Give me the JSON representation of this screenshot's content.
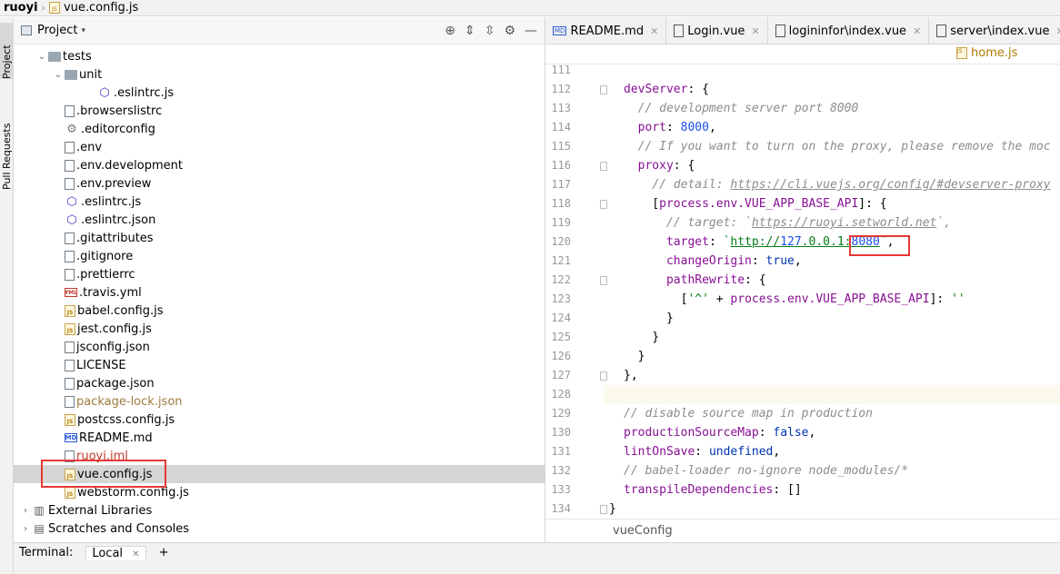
{
  "breadcrumb": {
    "root": "ruoyi",
    "file": "vue.config.js"
  },
  "side_tabs": {
    "project": "Project",
    "pull_requests": "Pull Requests"
  },
  "project_panel": {
    "title": "Project"
  },
  "tree": [
    {
      "name": "tests",
      "icon": "folder-icon",
      "indent": 1,
      "chev": "v"
    },
    {
      "name": "unit",
      "icon": "folder-icon",
      "indent": 2,
      "chev": "v"
    },
    {
      "name": ".eslintrc.js",
      "icon": "eslint-icon",
      "indent": 4
    },
    {
      "name": ".browserslistrc",
      "icon": "file-icon",
      "indent": 2
    },
    {
      "name": ".editorconfig",
      "icon": "gear-icon",
      "indent": 2
    },
    {
      "name": ".env",
      "icon": "file-icon",
      "indent": 2
    },
    {
      "name": ".env.development",
      "icon": "file-icon",
      "indent": 2
    },
    {
      "name": ".env.preview",
      "icon": "file-icon",
      "indent": 2
    },
    {
      "name": ".eslintrc.js",
      "icon": "eslint-icon",
      "indent": 2
    },
    {
      "name": ".eslintrc.json",
      "icon": "eslint-icon",
      "indent": 2
    },
    {
      "name": ".gitattributes",
      "icon": "file-icon",
      "indent": 2
    },
    {
      "name": ".gitignore",
      "icon": "file-icon",
      "indent": 2
    },
    {
      "name": ".prettierrc",
      "icon": "file-icon",
      "indent": 2
    },
    {
      "name": ".travis.yml",
      "icon": "yml-icon",
      "indent": 2
    },
    {
      "name": "babel.config.js",
      "icon": "js-icon",
      "indent": 2
    },
    {
      "name": "jest.config.js",
      "icon": "js-icon",
      "indent": 2
    },
    {
      "name": "jsconfig.json",
      "icon": "file-icon",
      "indent": 2
    },
    {
      "name": "LICENSE",
      "icon": "file-icon",
      "indent": 2
    },
    {
      "name": "package.json",
      "icon": "file-icon",
      "indent": 2
    },
    {
      "name": "package-lock.json",
      "icon": "file-icon",
      "indent": 2,
      "style": "muted"
    },
    {
      "name": "postcss.config.js",
      "icon": "js-icon",
      "indent": 2
    },
    {
      "name": "README.md",
      "icon": "md-icon",
      "indent": 2
    },
    {
      "name": "ruoyi.iml",
      "icon": "file-icon",
      "indent": 2,
      "style": "red"
    },
    {
      "name": "vue.config.js",
      "icon": "js-icon",
      "indent": 2,
      "selected": true
    },
    {
      "name": "webstorm.config.js",
      "icon": "js-icon",
      "indent": 2
    },
    {
      "name": "External Libraries",
      "icon": "library-icon",
      "indent": 0,
      "chev": ">"
    },
    {
      "name": "Scratches and Consoles",
      "icon": "scratches-icon",
      "indent": 0,
      "chev": ">"
    }
  ],
  "editor": {
    "tabs": [
      "README.md",
      "Login.vue",
      "logininfor\\index.vue",
      "server\\index.vue"
    ],
    "second_tab": "home.js",
    "bottom_breadcrumb": "vueConfig"
  },
  "code": {
    "line_numbers": [
      "111",
      "112",
      "113",
      "114",
      "115",
      "116",
      "117",
      "118",
      "119",
      "120",
      "121",
      "122",
      "123",
      "124",
      "125",
      "126",
      "127",
      "128",
      "129",
      "130",
      "131",
      "132",
      "133",
      "134"
    ],
    "lines": [
      "",
      "devServer: {",
      "  // development server port 8000",
      "  port: 8000,",
      "  // If you want to turn on the proxy, please remove the moc",
      "  proxy: {",
      "    // detail: https://cli.vuejs.org/config/#devserver-proxy",
      "    [process.env.VUE_APP_BASE_API]: {",
      "      // target: `https://ruoyi.setworld.net`,",
      "      target: `http://127.0.0.1:8080`,",
      "      changeOrigin: true,",
      "      pathRewrite: {",
      "        ['^' + process.env.VUE_APP_BASE_API]: ''",
      "      }",
      "    }",
      "  }",
      "},",
      "",
      "// disable source map in production",
      "productionSourceMap: false,",
      "lintOnSave: undefined,",
      "// babel-loader no-ignore node_modules/*",
      "transpileDependencies: []",
      "}"
    ]
  },
  "terminal": {
    "label": "Terminal:",
    "tab": "Local",
    "add": "+"
  }
}
